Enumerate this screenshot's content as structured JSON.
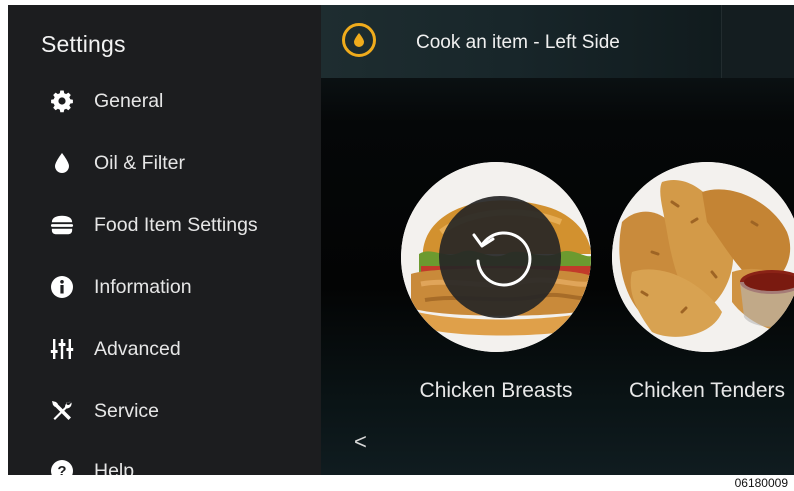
{
  "sidebar": {
    "title": "Settings",
    "items": [
      {
        "label": "General",
        "icon": "gear-icon"
      },
      {
        "label": "Oil & Filter",
        "icon": "oil-drop-icon"
      },
      {
        "label": "Food Item Settings",
        "icon": "burger-icon"
      },
      {
        "label": "Information",
        "icon": "info-icon"
      },
      {
        "label": "Advanced",
        "icon": "sliders-icon"
      },
      {
        "label": "Service",
        "icon": "tools-icon"
      },
      {
        "label": "Help",
        "icon": "help-icon"
      }
    ]
  },
  "header": {
    "title": "Cook an item - Left Side",
    "badge_icon": "oil-drop-icon",
    "badge_color": "#f0ac1c"
  },
  "food_items": [
    {
      "label": "Chicken Breasts",
      "overlay_icon": "undo-icon"
    },
    {
      "label": "Chicken Tenders"
    }
  ],
  "navigation": {
    "back_symbol": "<"
  },
  "figure_id": "06180009",
  "colors": {
    "sidebar_bg": "#1c1d1f",
    "accent": "#f0ac1c",
    "text": "#e6e6e6"
  }
}
